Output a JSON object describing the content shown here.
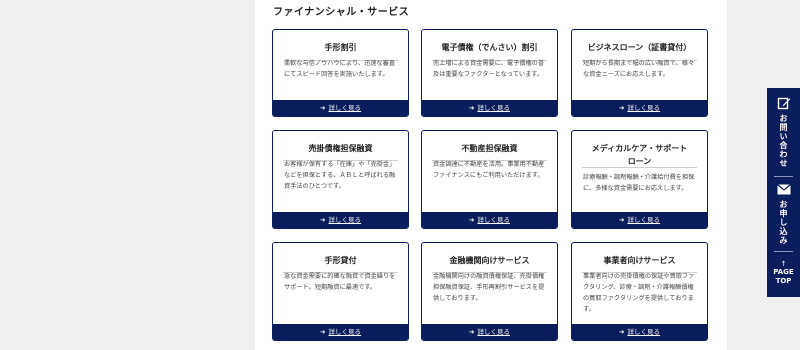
{
  "section_title": "ファイナンシャル・サービス",
  "more_label": "詳しく見る",
  "cards": [
    {
      "title": "手形割引",
      "desc": "柔軟な与信ノウハウにより、迅速な審査にてスピード回答を実施いたします。"
    },
    {
      "title": "電子債権（でんさい）割引",
      "desc": "売上増による資金需要に、電子債権の普及は重要なファクターとなっています。"
    },
    {
      "title": "ビジネスローン（証書貸付）",
      "desc": "短期から長期まで幅の広い融資で、様々な資金ニーズにお応えします。"
    },
    {
      "title": "売掛債権担保融資",
      "desc": "お客様が保有する「在庫」や「売掛金」などを担保とする、ＡＢＬと呼ばれる融資手法のひとつです。"
    },
    {
      "title": "不動産担保融資",
      "desc": "資金調達に不動産を活用。事業用不動産ファイナンスにもご利用いただけます。"
    },
    {
      "title": "メディカルケア・サポートローン",
      "desc": "診療報酬・調剤報酬・介護給付費を担保に、多様な資金需要にお応えします。"
    },
    {
      "title": "手形貸付",
      "desc": "急な資金需要に的確な融資で資金繰りをサポート。短期融資に最適です。"
    },
    {
      "title": "金融機関向けサービス",
      "desc": "金融機関向けの融資債権保証、売掛債権担保融資保証、手形再割引サービスを提供しております。"
    },
    {
      "title": "事業者向けサービス",
      "desc": "事業者向けの売掛債権の保証や買取ファクタリング、診療・調剤・介護報酬債権の買取ファクタリングを提供しております。"
    }
  ],
  "sidebar": {
    "contact_label": "お問い合わせ",
    "apply_label": "お申し込み",
    "page_top_line1": "PAGE",
    "page_top_line2": "TOP"
  }
}
